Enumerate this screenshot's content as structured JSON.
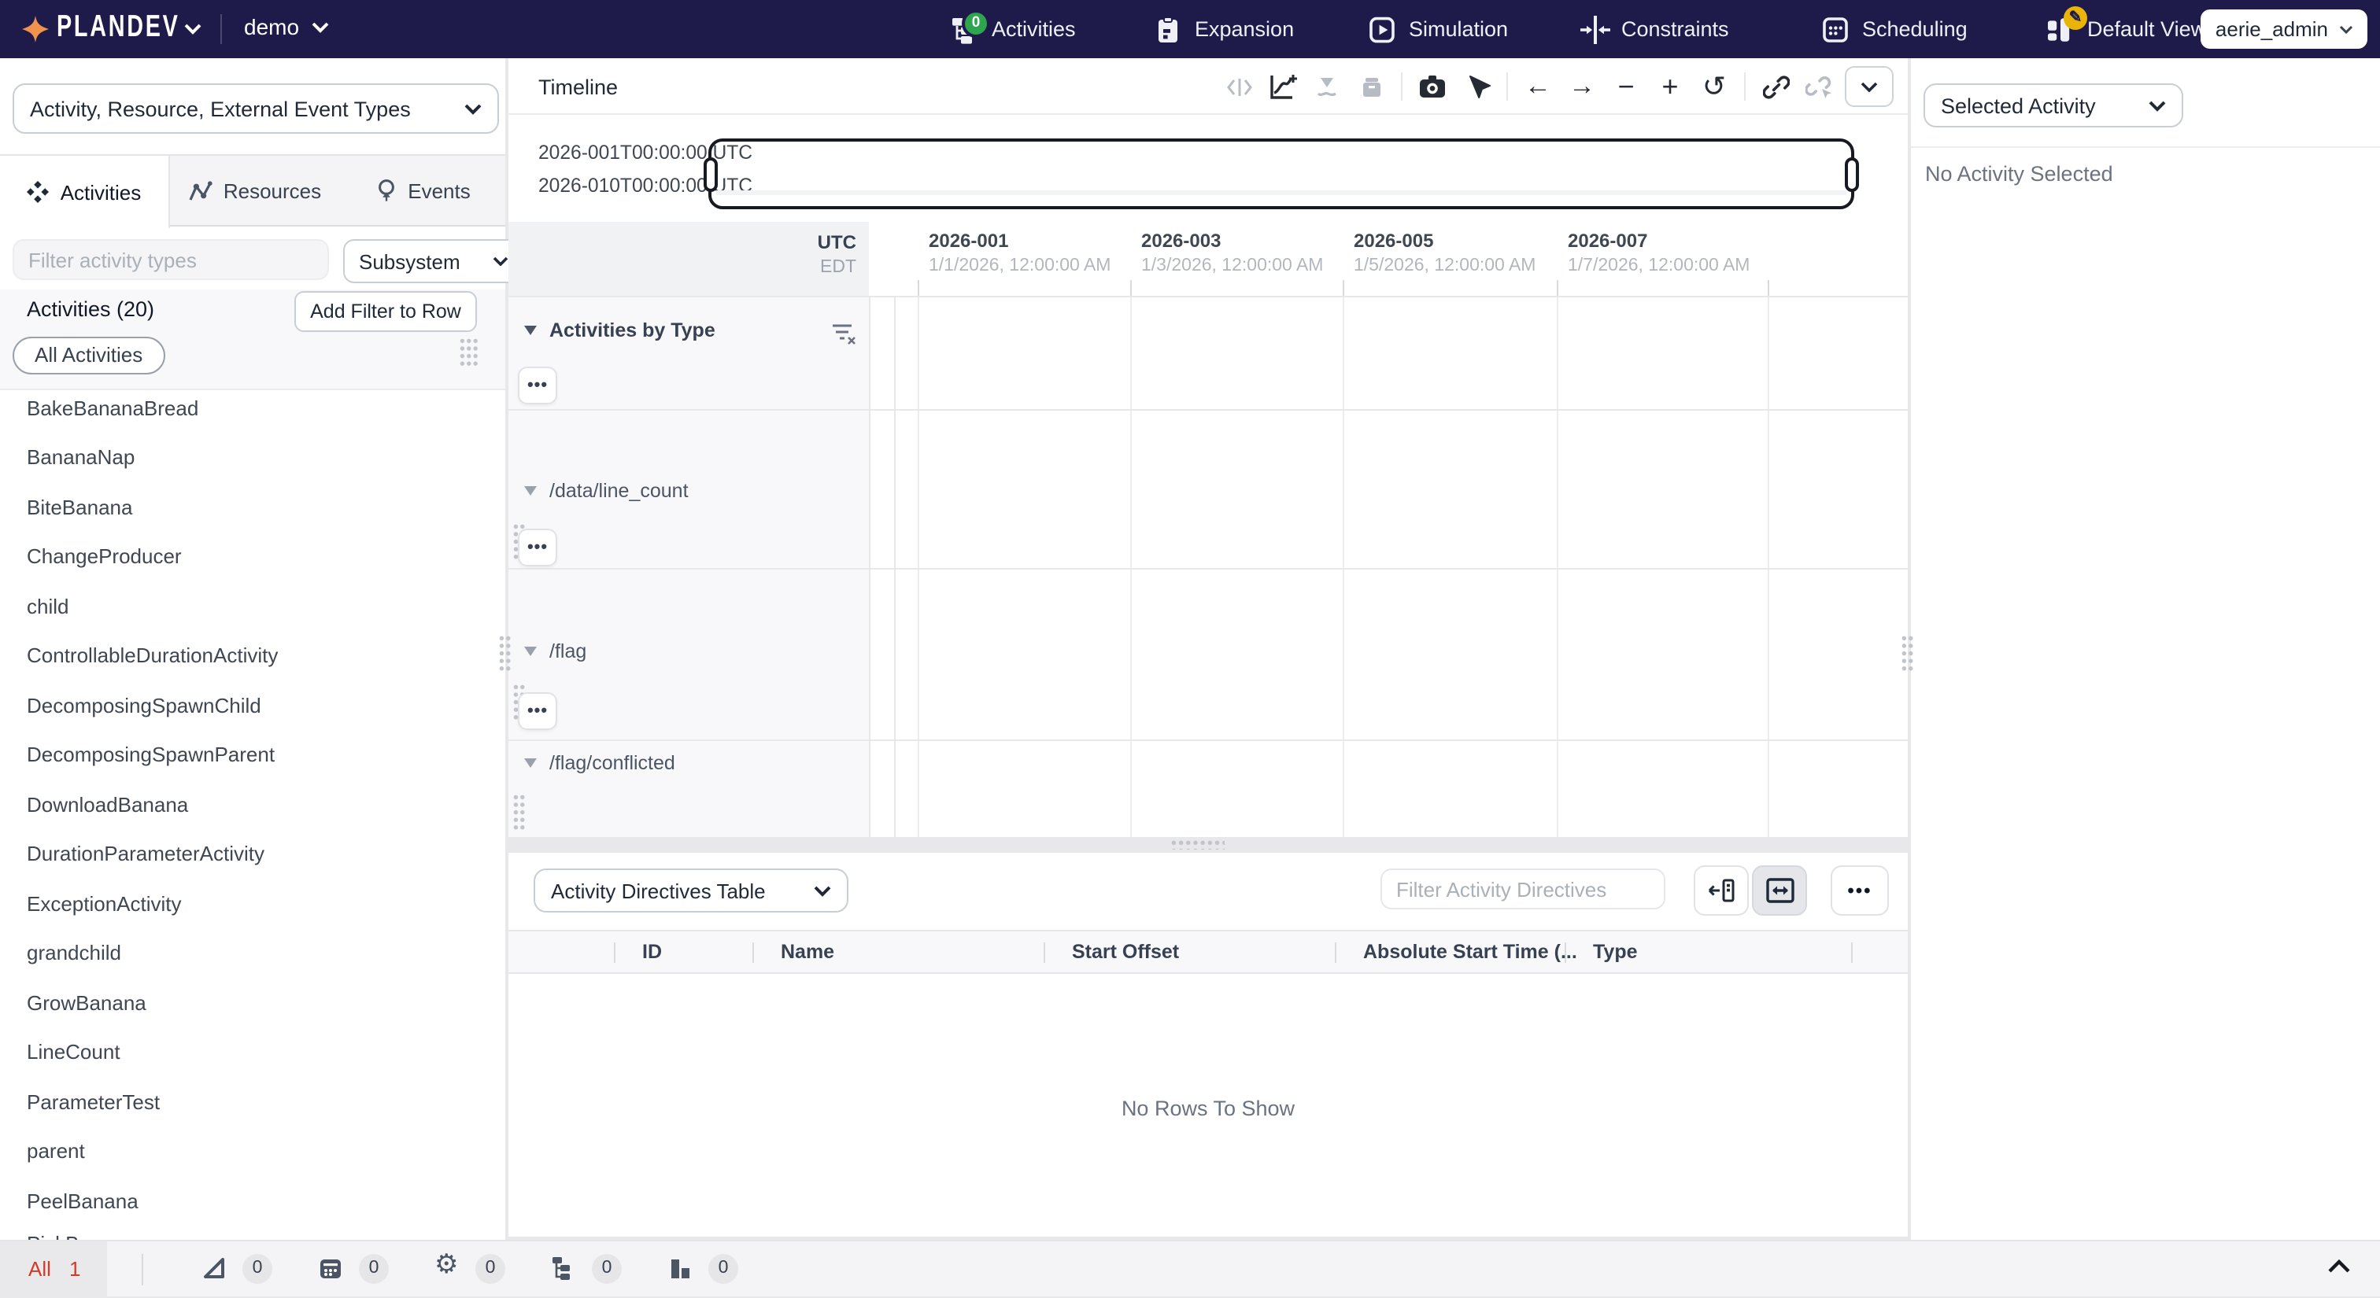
{
  "app": {
    "logo": "PLANDEV",
    "plan_name": "demo"
  },
  "header": {
    "nav": [
      {
        "label": "Activities",
        "badge": "0"
      },
      {
        "label": "Expansion"
      },
      {
        "label": "Simulation"
      },
      {
        "label": "Constraints"
      },
      {
        "label": "Scheduling"
      },
      {
        "label": "Default View"
      }
    ],
    "user_menu": "aerie_admin"
  },
  "left_panel": {
    "type_dropdown": "Activity, Resource, External Event Types",
    "tabs": [
      {
        "label": "Activities"
      },
      {
        "label": "Resources"
      },
      {
        "label": "Events"
      }
    ],
    "filter_placeholder": "Filter activity types",
    "subsystem_dropdown": "Subsystem",
    "section_title": "Activities (20)",
    "add_filter_button": "Add Filter to Row",
    "all_activities_chip": "All Activities",
    "activity_types": [
      "BakeBananaBread",
      "BananaNap",
      "BiteBanana",
      "ChangeProducer",
      "child",
      "ControllableDurationActivity",
      "DecomposingSpawnChild",
      "DecomposingSpawnParent",
      "DownloadBanana",
      "DurationParameterActivity",
      "ExceptionActivity",
      "grandchild",
      "GrowBanana",
      "LineCount",
      "ParameterTest",
      "parent",
      "PeelBanana",
      "PickBanana"
    ]
  },
  "timeline": {
    "title": "Timeline",
    "range_start": "2026-001T00:00:00 UTC",
    "range_end": "2026-010T00:00:00 UTC",
    "timezone_primary": "UTC",
    "timezone_secondary": "EDT",
    "ticks": [
      {
        "label": "2026-001",
        "sublabel": "1/1/2026, 12:00:00 AM"
      },
      {
        "label": "2026-003",
        "sublabel": "1/3/2026, 12:00:00 AM"
      },
      {
        "label": "2026-005",
        "sublabel": "1/5/2026, 12:00:00 AM"
      },
      {
        "label": "2026-007",
        "sublabel": "1/7/2026, 12:00:00 AM"
      }
    ],
    "rows": [
      {
        "label": "Activities by Type"
      },
      {
        "label": "/data/line_count"
      },
      {
        "label": "/flag"
      },
      {
        "label": "/flag/conflicted"
      }
    ],
    "row_menu": "•••"
  },
  "bottom_panel": {
    "table_dropdown": "Activity Directives Table",
    "filter_placeholder": "Filter Activity Directives",
    "columns": [
      "ID",
      "Name",
      "Start Offset",
      "Absolute Start Time (...",
      "Type"
    ],
    "empty_message": "No Rows To Show"
  },
  "right_panel": {
    "dropdown": "Selected Activity",
    "empty_message": "No Activity Selected"
  },
  "status_bar": {
    "all_label": "All",
    "all_count": "1",
    "counters": [
      {
        "icon": "triangle-ruler-icon",
        "count": "0"
      },
      {
        "icon": "calendar-icon",
        "count": "0"
      },
      {
        "icon": "gear-icon",
        "count": "0"
      },
      {
        "icon": "hierarchy-icon",
        "count": "0"
      },
      {
        "icon": "bar-chart-icon",
        "count": "0"
      }
    ]
  },
  "icons": {
    "arrow_left": "←",
    "arrow_right": "→",
    "minus": "−",
    "plus": "+",
    "undo": "↺",
    "resize_horizontal": "↔",
    "gear": "⚙"
  },
  "colors": {
    "header_bg": "#1e1b4b",
    "badge_green": "#2da44e",
    "badge_yellow": "#eab308",
    "status_red": "#d23b26",
    "logo_star": "#f0944d"
  }
}
